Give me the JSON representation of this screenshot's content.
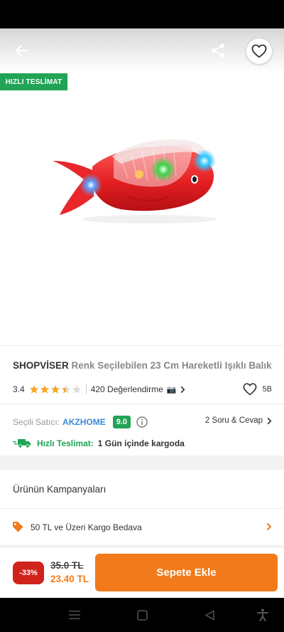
{
  "header": {
    "back_icon": "arrow-left-icon",
    "share_icon": "share-icon",
    "favorite_icon": "heart-outline-icon"
  },
  "image_area": {
    "badge": "HIZLI TESLİMAT",
    "product_image": "red-light-up-fish-toy"
  },
  "product": {
    "brand": "SHOPVİSER",
    "name": "Renk Seçilebilen 23 Cm Hareketli Işıklı Balık",
    "rating": "3.4",
    "stars_value": 3.4,
    "stars_max": 5,
    "reviews": "420 Değerlendirme",
    "camera_icon": "📷",
    "likes": "5B"
  },
  "seller": {
    "label": "Seçili Satıcı:",
    "name": "AKZHOME",
    "score": "9.0",
    "qa": "2 Soru & Cevap"
  },
  "delivery": {
    "label": "Hızlı Teslimat:",
    "text": "1 Gün içinde kargoda"
  },
  "campaigns": {
    "title": "Ürünün Kampanyaları",
    "items": [
      {
        "text": "50 TL ve Üzeri Kargo Bedava"
      }
    ]
  },
  "purchase": {
    "discount": "-33%",
    "old_price": "35.0 TL",
    "new_price": "23.40 TL",
    "cart_button": "Sepete Ekle"
  },
  "colors": {
    "accent_orange": "#f27a1a",
    "green": "#21a455",
    "discount_red": "#d0231c",
    "link_blue": "#3a8bd6",
    "star": "#f5a623"
  },
  "system_nav": {
    "menu_icon": "menu-icon",
    "home_icon": "square-home-icon",
    "back_icon": "triangle-back-icon",
    "accessibility_icon": "accessibility-icon"
  }
}
